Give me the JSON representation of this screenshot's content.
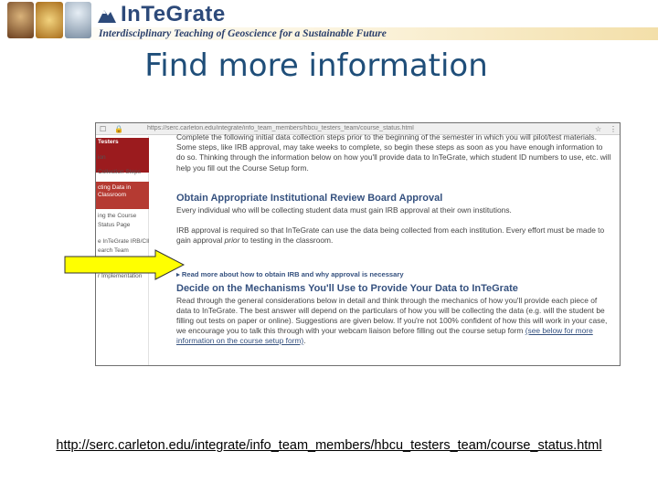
{
  "header": {
    "brand_name": "InTeGrate",
    "tagline": "Interdisciplinary Teaching of Geoscience for a Sustainable Future"
  },
  "slide": {
    "title": "Find more information"
  },
  "screenshot": {
    "url": "https://serc.carleton.edu/integrate/info_team_members/hbcu_testers_team/course_status.html",
    "sidebar": {
      "items": [
        {
          "label": "Testers"
        },
        {
          "label": "ion"
        },
        {
          "label": "Collection Steps"
        },
        {
          "label": "cting Data in"
        },
        {
          "label": "Classroom"
        },
        {
          "label": "ing the Course"
        },
        {
          "label": "Status Page"
        },
        {
          "label": "e InTeGrate IRB/CII"
        },
        {
          "label": "earch Team"
        },
        {
          "label": "r Implementation"
        }
      ]
    },
    "intro": "Complete the following initial data collection steps prior to the beginning of the semester in which you will pilot/test materials. Some steps, like IRB approval, may take weeks to complete, so begin these steps as soon as you have enough information to do so. Thinking through the information below on how you'll provide data to InTeGrate, which student ID numbers to use, etc. will help you fill out the Course Setup form.",
    "section1": {
      "heading": "Obtain Appropriate Institutional Review Board Approval",
      "para1": "Every individual who will be collecting student data must gain IRB approval at their own institutions.",
      "para2_before": "IRB approval is required so that InTeGrate can use the data being collected from each institution. Every effort must be made to gain approval ",
      "para2_em": "prior",
      "para2_after": " to testing in the classroom.",
      "read_more": "▸ Read more about how to obtain IRB and why approval is necessary"
    },
    "section2": {
      "heading": "Decide on the Mechanisms You'll Use to Provide Your Data to InTeGrate",
      "para_before": "Read through the general considerations below in detail and think through the mechanics of how you'll provide each piece of data to InTeGrate. The best answer will depend on the particulars of how you will be collecting the data (e.g. will the student be filling out tests on paper or online). Suggestions are given below. If you're not 100% confident of how this will work in your case, we encourage you to talk this through with your webcam liaison before filling out the course setup form ",
      "link": "(see below for more information on the course setup form)",
      "para_after": "."
    }
  },
  "footer": {
    "url": "http://serc.carleton.edu/integrate/info_team_members/hbcu_testers_team/course_status.html"
  },
  "colors": {
    "title": "#1f4e79",
    "brand": "#2d4a7a",
    "sidebar_red": "#9b1b1e",
    "heading_blue": "#35517f",
    "arrow_yellow": "#ffff00"
  }
}
